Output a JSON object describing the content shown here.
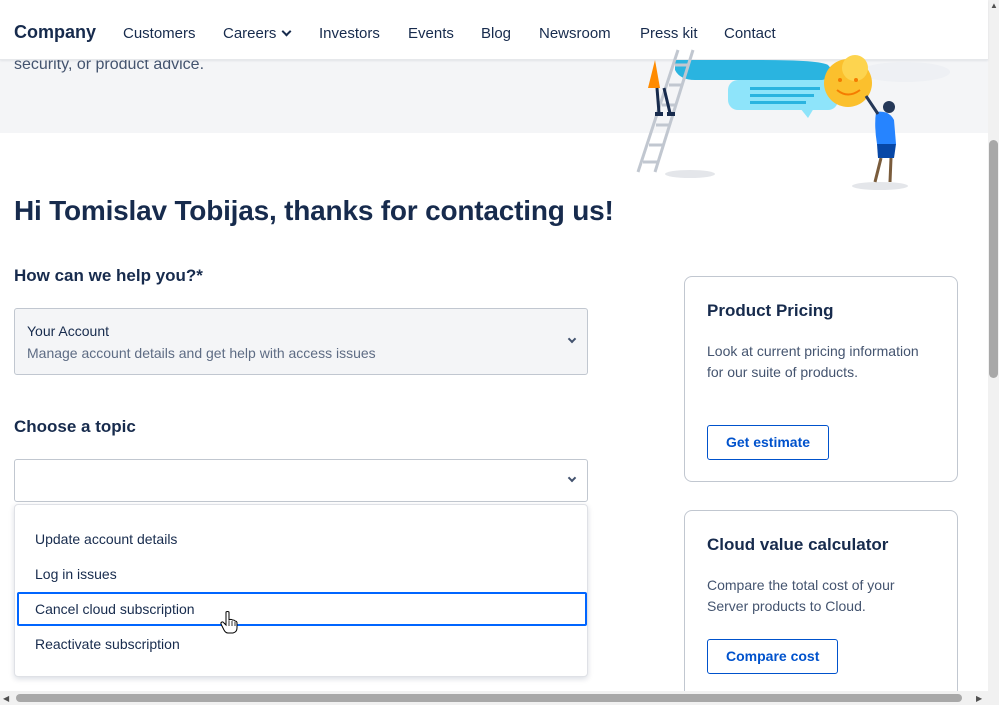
{
  "nav": {
    "brand": "Company",
    "items": [
      "Customers",
      "Careers",
      "Investors",
      "Events",
      "Blog",
      "Newsroom",
      "Press kit",
      "Contact"
    ]
  },
  "hero": {
    "text": "security, or product advice."
  },
  "headline": "Hi Tomislav Tobijas, thanks for contacting us!",
  "help": {
    "label": "How can we help you?*",
    "selected_title": "Your Account",
    "selected_subtitle": "Manage account details and get help with access issues"
  },
  "topic": {
    "label": "Choose a topic",
    "value": "",
    "options": [
      "Update account details",
      "Log in issues",
      "Cancel cloud subscription",
      "Reactivate subscription"
    ],
    "highlighted_index": 2
  },
  "cards": [
    {
      "title": "Product Pricing",
      "description": "Look at current pricing information for our suite of products.",
      "button": "Get estimate"
    },
    {
      "title": "Cloud value calculator",
      "description": "Compare the total cost of your Server products to Cloud.",
      "button": "Compare cost"
    }
  ],
  "colors": {
    "text": "#172B4D",
    "link_blue": "#0052CC",
    "highlight_border": "#0065FF",
    "hero_bg": "#f4f5f7"
  }
}
